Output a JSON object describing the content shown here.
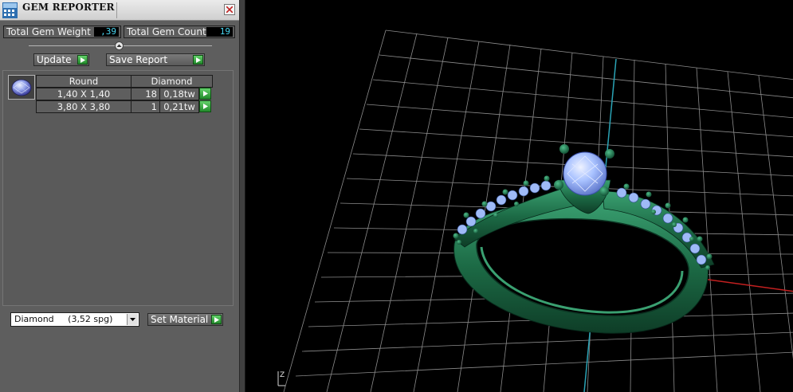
{
  "window": {
    "title": "GEM REPORTER"
  },
  "stats": {
    "weight_label": "Total Gem Weight",
    "weight_value": ",39",
    "count_label": "Total Gem Count",
    "count_value": "19"
  },
  "buttons": {
    "update": "Update",
    "save_report": "Save Report",
    "set_material": "Set Material"
  },
  "table": {
    "headers": [
      "Round",
      "Diamond"
    ],
    "rows": [
      {
        "size": "1,40 X 1,40",
        "count": "18",
        "weight": "0,18tw"
      },
      {
        "size": "3,80 X 3,80",
        "count": "1",
        "weight": "0,21tw"
      }
    ]
  },
  "material": {
    "selected": "Diamond     (3,52 spg)"
  },
  "viewport": {
    "axis_label": "Z"
  },
  "colors": {
    "panel_bg": "#5e5e5e",
    "value_text": "#49d7f2",
    "go_button": "#3fb548",
    "ring_metal": "#1d6e46",
    "gem": "#8fb4ff",
    "grid": "#8a8a8a",
    "z_axis": "#2aa3b5",
    "x_axis": "#c42020"
  },
  "icons": {
    "app": "gem-reporter-app-icon",
    "close": "close-icon",
    "slider": "collapse-slider-icon",
    "go": "green-go-arrow-icon",
    "dropdown": "chevron-down-icon",
    "thumbnail": "round-gem-thumbnail"
  }
}
